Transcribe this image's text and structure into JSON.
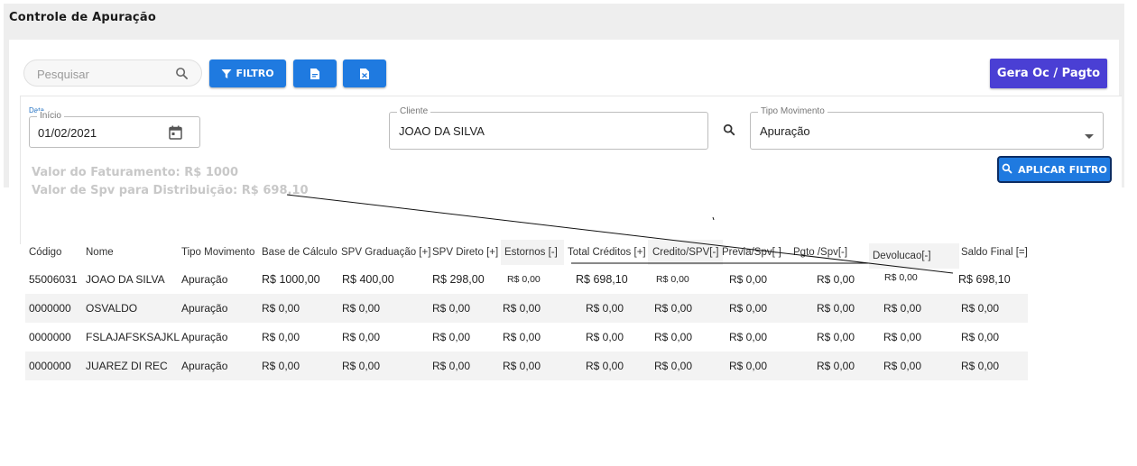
{
  "page": {
    "title": "Controle de Apuração"
  },
  "toolbar": {
    "search_placeholder": "Pesquisar",
    "filtro_label": "FILTRO",
    "gera_label": "Gera Oc / Pagto"
  },
  "filters": {
    "data_tag": "Data",
    "inicio_label": "Início",
    "inicio_value": "01/02/2021",
    "cliente_label": "Cliente",
    "cliente_value": "JOAO DA SILVA",
    "tipo_label": "Tipo Movimento",
    "tipo_value": "Apuração",
    "aplicar_label": "APLICAR FILTRO"
  },
  "summary": {
    "faturamento": "Valor do Faturamento: R$ 1000",
    "spv_distribuicao": "Valor de Spv para Distribuição: R$ 698,10"
  },
  "table": {
    "columns": [
      "Código",
      "Nome",
      "Tipo Movimento",
      "Base de Cálculo",
      "SPV Graduação [+]",
      "SPV Direto [+]",
      "Estornos [-]",
      "Total Créditos [+]",
      "Credito/SPV[-]",
      "Previa/Spv[-]",
      "Pgto /Spv[-]",
      "Devolucao[-]",
      "Saldo Final [=]"
    ],
    "rows": [
      [
        "55006031",
        "JOAO DA SILVA",
        "Apuração",
        "R$ 1000,00",
        "R$ 400,00",
        "R$ 298,00",
        "R$ 0,00",
        "R$ 698,10",
        "R$ 0,00",
        "R$ 0,00",
        "R$ 0,00",
        "R$ 0,00",
        "R$ 698,10"
      ],
      [
        "0000000",
        "OSVALDO",
        "Apuração",
        "R$ 0,00",
        "R$ 0,00",
        "R$ 0,00",
        "R$ 0,00",
        "R$ 0,00",
        "R$ 0,00",
        "R$ 0,00",
        "R$ 0,00",
        "R$ 0,00",
        "R$ 0,00"
      ],
      [
        "0000000",
        "FSLAJAFSKSAJKL",
        "Apuração",
        "R$ 0,00",
        "R$ 0,00",
        "R$ 0,00",
        "R$ 0,00",
        "R$ 0,00",
        "R$ 0,00",
        "R$ 0,00",
        "R$ 0,00",
        "R$ 0,00",
        "R$ 0,00"
      ],
      [
        "0000000",
        "JUAREZ DI REC",
        "Apuração",
        "R$ 0,00",
        "R$ 0,00",
        "R$ 0,00",
        "R$ 0,00",
        "R$ 0,00",
        "R$ 0,00",
        "R$ 0,00",
        "R$ 0,00",
        "R$ 0,00",
        "R$ 0,00"
      ]
    ]
  },
  "colors": {
    "primary": "#1f7ae0",
    "gera": "#4a3fd4",
    "topbar": "#eeeeee"
  }
}
